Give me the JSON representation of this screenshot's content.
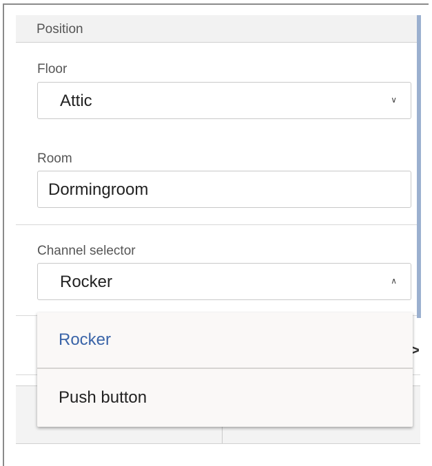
{
  "position": {
    "section_title": "Position",
    "floor": {
      "label": "Floor",
      "value": "Attic",
      "chevron": "∨",
      "icon": "chevron-down-icon"
    },
    "room": {
      "label": "Room",
      "value": "Dormingroom"
    },
    "channel_selector": {
      "label": "Channel selector",
      "value": "Rocker",
      "chevron": "∧",
      "icon": "chevron-up-icon",
      "options": [
        {
          "label": "Rocker",
          "selected": true
        },
        {
          "label": "Push button",
          "selected": false
        }
      ]
    }
  },
  "right_arrow": ">",
  "colors": {
    "selected_option": "#3a64a8",
    "option_text": "#222222",
    "scrollbar": "#9bb0cf"
  }
}
